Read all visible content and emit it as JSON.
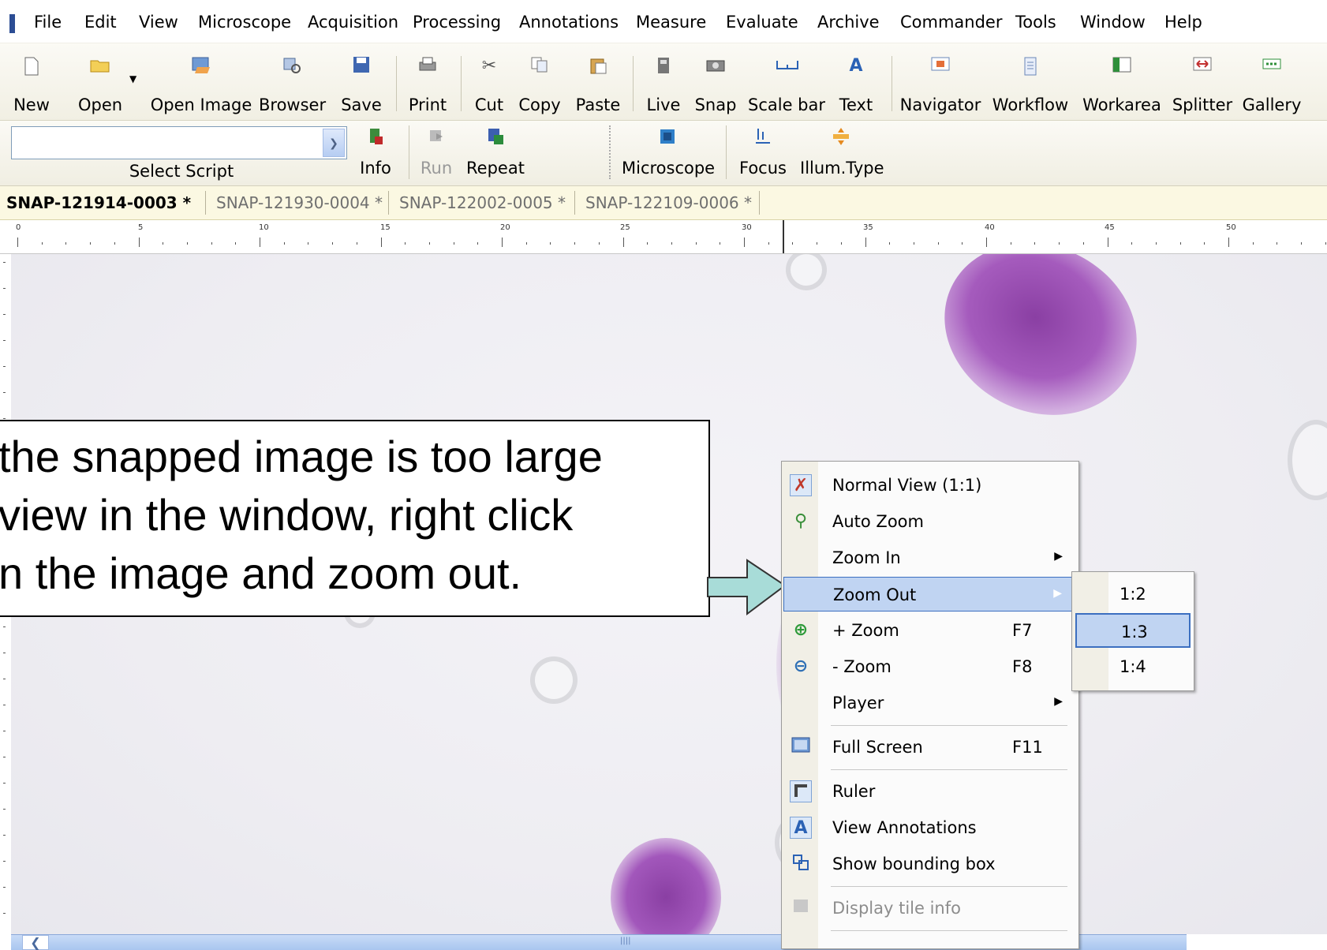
{
  "menubar": {
    "items": [
      "File",
      "Edit",
      "View",
      "Microscope",
      "Acquisition",
      "Processing",
      "Annotations",
      "Measure",
      "Evaluate",
      "Archive",
      "Commander",
      "Tools",
      "Window",
      "Help"
    ]
  },
  "toolbar": {
    "buttons": [
      {
        "label": "New",
        "icon": "new-document-icon"
      },
      {
        "label": "Open",
        "icon": "open-folder-icon"
      },
      {
        "label": "Open Image",
        "icon": "open-image-icon"
      },
      {
        "label": "Browser",
        "icon": "browser-icon"
      },
      {
        "label": "Save",
        "icon": "floppy-disk-icon"
      },
      {
        "label": "Print",
        "icon": "printer-icon"
      },
      {
        "label": "Cut",
        "icon": "scissors-icon"
      },
      {
        "label": "Copy",
        "icon": "copy-icon"
      },
      {
        "label": "Paste",
        "icon": "paste-icon"
      },
      {
        "label": "Live",
        "icon": "camera-live-icon"
      },
      {
        "label": "Snap",
        "icon": "camera-snap-icon"
      },
      {
        "label": "Scale bar",
        "icon": "scale-bar-icon"
      },
      {
        "label": "Text",
        "icon": "text-tool-icon"
      },
      {
        "label": "Navigator",
        "icon": "navigator-icon"
      },
      {
        "label": "Workflow",
        "icon": "workflow-icon"
      },
      {
        "label": "Workarea",
        "icon": "workarea-icon"
      },
      {
        "label": "Splitter",
        "icon": "splitter-icon"
      },
      {
        "label": "Gallery",
        "icon": "gallery-icon"
      }
    ]
  },
  "script_toolbar": {
    "select_label": "Select Script",
    "select_value": "",
    "buttons": [
      {
        "label": "Info",
        "icon": "info-book-icon",
        "enabled": true
      },
      {
        "label": "Run",
        "icon": "run-icon",
        "enabled": false
      },
      {
        "label": "Repeat",
        "icon": "repeat-icon",
        "enabled": true
      },
      {
        "label": "Microscope",
        "icon": "microscope-icon",
        "enabled": true
      },
      {
        "label": "Focus",
        "icon": "focus-icon",
        "enabled": true
      },
      {
        "label": "Illum.Type",
        "icon": "illumination-icon",
        "enabled": true
      }
    ]
  },
  "tabs": [
    {
      "label": "SNAP-121914-0003 *",
      "active": true
    },
    {
      "label": "SNAP-121930-0004 *",
      "active": false
    },
    {
      "label": "SNAP-122002-0005 *",
      "active": false
    },
    {
      "label": "SNAP-122109-0006 *",
      "active": false
    }
  ],
  "ruler": {
    "labels": [
      "0",
      "5",
      "10",
      "15",
      "20",
      "25",
      "30",
      "35",
      "40",
      "45",
      "50"
    ]
  },
  "callout": {
    "lines": [
      "the snapped image is too large",
      "view in the window, right click",
      "n the image and zoom out."
    ]
  },
  "context_menu": {
    "items": [
      {
        "label": "Normal View (1:1)",
        "icon": "normal-view-icon",
        "shortcut": "",
        "submenu": false
      },
      {
        "label": "Auto Zoom",
        "icon": "auto-zoom-icon",
        "shortcut": "",
        "submenu": false
      },
      {
        "label": "Zoom In",
        "icon": "",
        "shortcut": "",
        "submenu": true
      },
      {
        "label": "Zoom Out",
        "icon": "",
        "shortcut": "",
        "submenu": true,
        "highlighted": true
      },
      {
        "label": "+ Zoom",
        "icon": "zoom-plus-icon",
        "shortcut": "F7",
        "submenu": false
      },
      {
        "label": "- Zoom",
        "icon": "zoom-minus-icon",
        "shortcut": "F8",
        "submenu": false
      },
      {
        "label": "Player",
        "icon": "",
        "shortcut": "",
        "submenu": true
      },
      {
        "label": "Full Screen",
        "icon": "full-screen-icon",
        "shortcut": "F11",
        "submenu": false
      },
      {
        "label": "Ruler",
        "icon": "ruler-icon",
        "shortcut": "",
        "submenu": false
      },
      {
        "label": "View Annotations",
        "icon": "annotations-icon",
        "shortcut": "",
        "submenu": false
      },
      {
        "label": "Show bounding box",
        "icon": "bounding-box-icon",
        "shortcut": "",
        "submenu": false
      },
      {
        "label": "Display tile info",
        "icon": "tile-info-icon",
        "shortcut": "",
        "submenu": false,
        "disabled": true
      }
    ]
  },
  "zoom_out_submenu": {
    "items": [
      {
        "label": "1:2",
        "highlighted": false
      },
      {
        "label": "1:3",
        "highlighted": true
      },
      {
        "label": "1:4",
        "highlighted": false
      }
    ]
  },
  "colors": {
    "accent": "#3c6fc0",
    "highlight": "#c0d4f2",
    "cell_purple": "#9a4fb0"
  }
}
